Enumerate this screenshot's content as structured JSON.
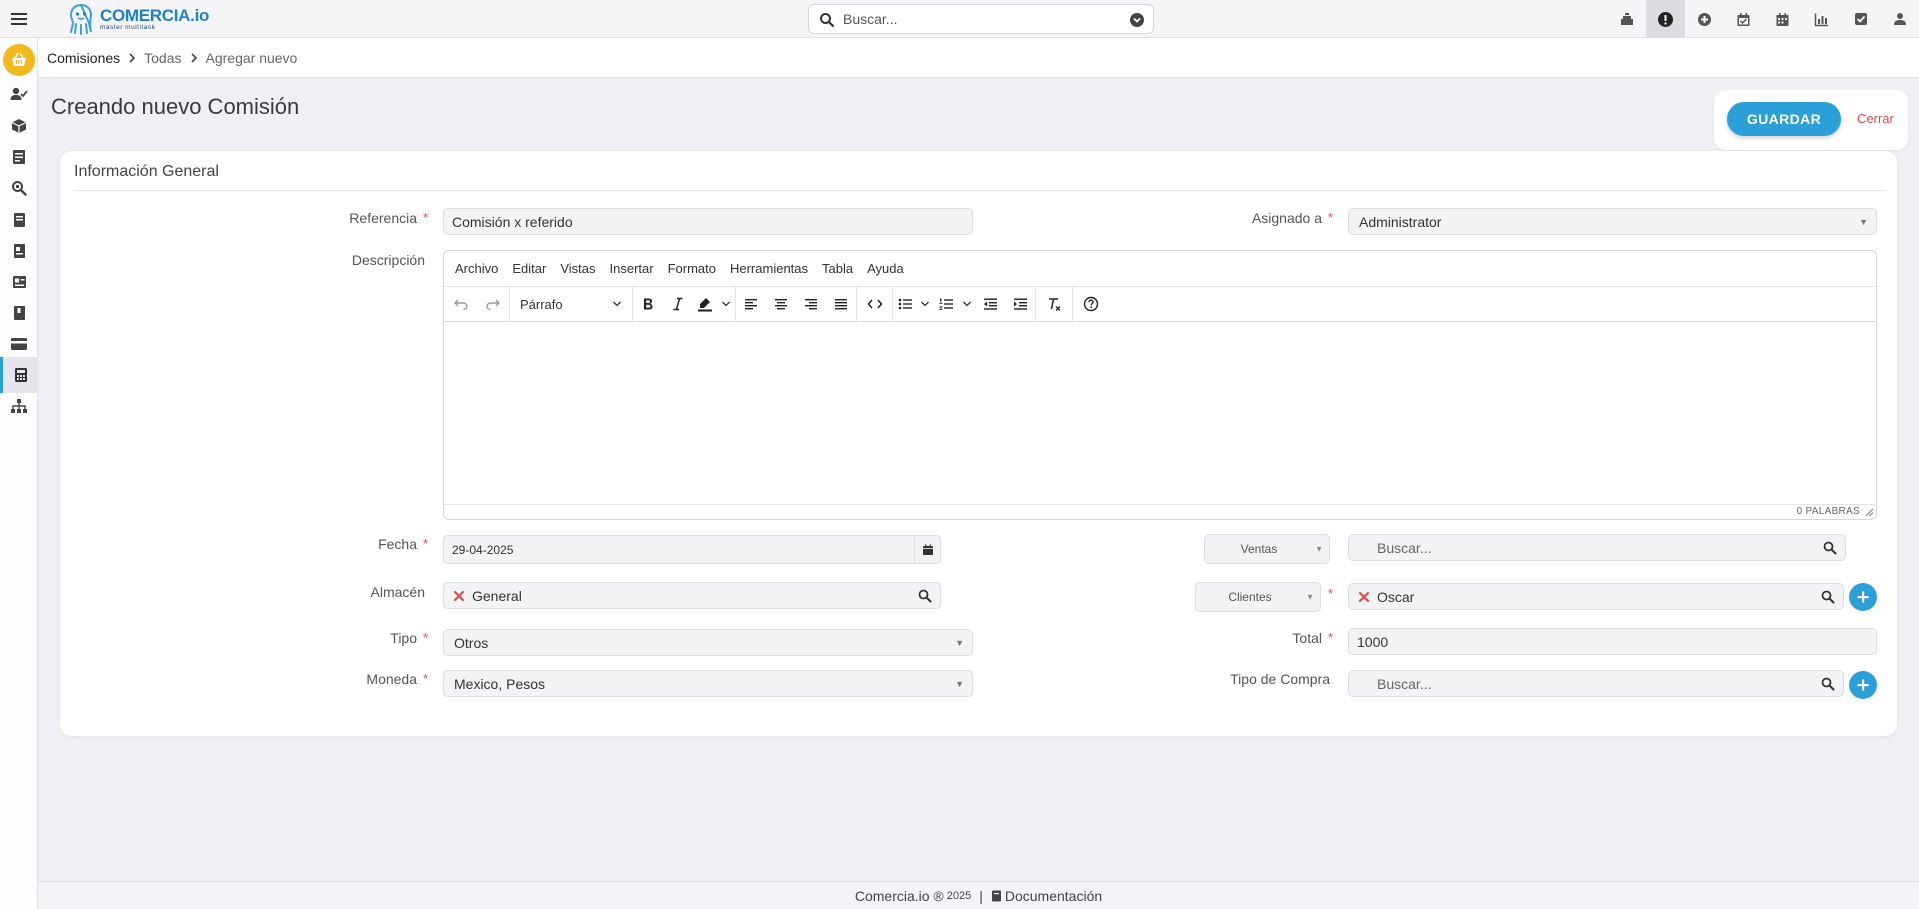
{
  "brand": {
    "name": "COMERCIA",
    "suffix": ".io",
    "tagline": "master multitask"
  },
  "search": {
    "placeholder": "Buscar..."
  },
  "breadcrumb": {
    "root": "Comisiones",
    "level2": "Todas",
    "level3": "Agregar nuevo"
  },
  "page": {
    "title": "Creando nuevo Comisión",
    "save_label": "GUARDAR",
    "close_label": "Cerrar"
  },
  "card": {
    "title": "Información General"
  },
  "form": {
    "referencia": {
      "label": "Referencia",
      "value": "Comisión x referido"
    },
    "asignado": {
      "label": "Asignado a",
      "value": "Administrator"
    },
    "descripcion": {
      "label": "Descripción"
    },
    "fecha": {
      "label": "Fecha",
      "value": "29-04-2025"
    },
    "ventas": {
      "selector": "Ventas",
      "placeholder": "Buscar..."
    },
    "almacen": {
      "label": "Almacén",
      "value": "General"
    },
    "clientes": {
      "selector": "Clientes",
      "value": "Oscar"
    },
    "tipo": {
      "label": "Tipo",
      "value": "Otros"
    },
    "total": {
      "label": "Total",
      "value": "1000"
    },
    "moneda": {
      "label": "Moneda",
      "value": "Mexico, Pesos"
    },
    "tipo_compra": {
      "label": "Tipo de Compra",
      "placeholder": "Buscar..."
    }
  },
  "editor": {
    "menus": [
      "Archivo",
      "Editar",
      "Vistas",
      "Insertar",
      "Formato",
      "Herramientas",
      "Tabla",
      "Ayuda"
    ],
    "block_format": "Párrafo",
    "word_count": "0 PALABRAS"
  },
  "footer": {
    "brand": "Comercia.io ®",
    "year": "2025",
    "separator": "|",
    "docs": "Documentación"
  },
  "colors": {
    "accent": "#2ba0d8",
    "required": "#e24a4a",
    "home_badge": "#f2b91c",
    "brand": "#1f7fd1"
  }
}
